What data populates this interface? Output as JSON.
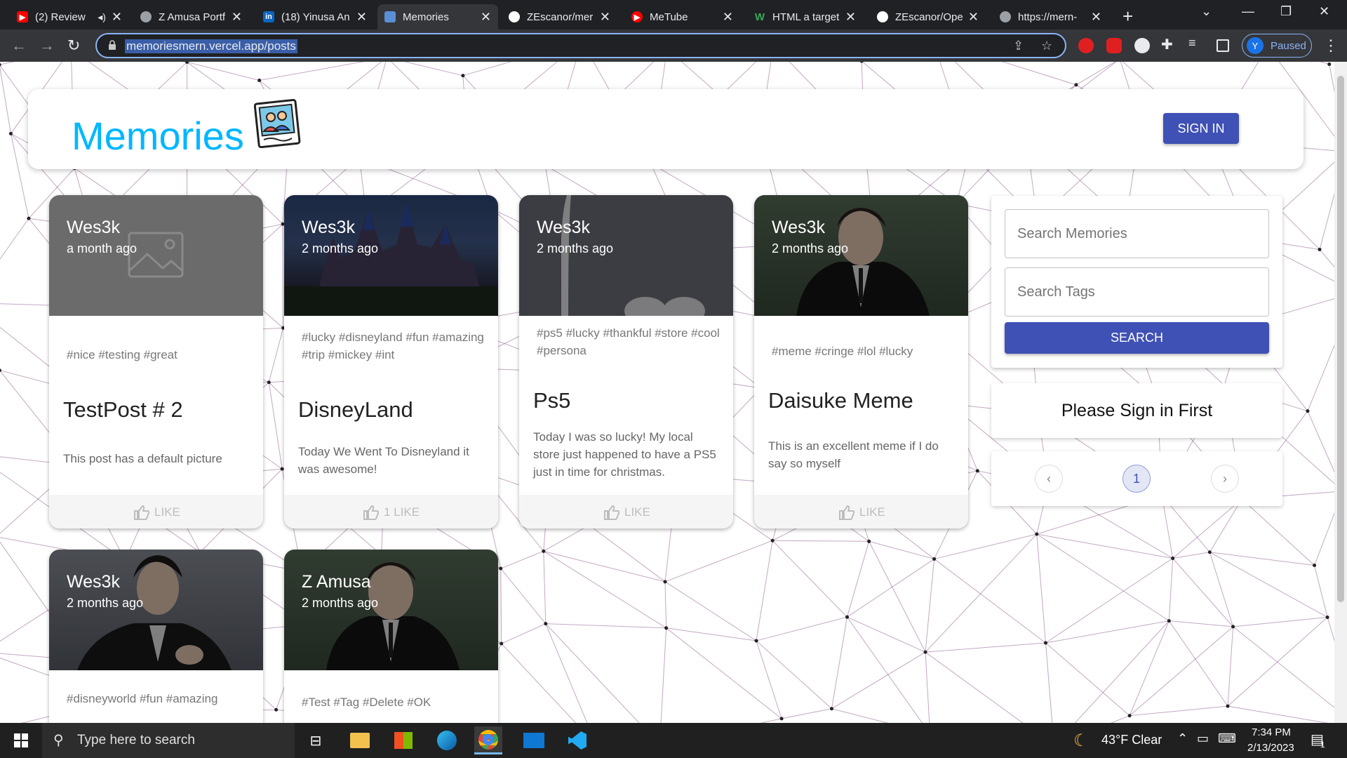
{
  "browser": {
    "tabs": [
      {
        "label": "(2) Review",
        "favicon_color": "#ff0000",
        "active": false
      },
      {
        "label": "Z Amusa Portf",
        "favicon_color": "#9aa0a6",
        "active": false
      },
      {
        "label": "(18) Yinusa An",
        "favicon_color": "#0a66c2",
        "favicon_text": "in",
        "active": false
      },
      {
        "label": "Memories",
        "favicon_color": "#5a8fd6",
        "active": true
      },
      {
        "label": "ZEscanor/mer",
        "favicon_color": "#ffffff",
        "active": false
      },
      {
        "label": "MeTube",
        "favicon_color": "#ff0000",
        "active": false
      },
      {
        "label": "HTML a target",
        "favicon_color": "#3aa757",
        "favicon_text": "W",
        "active": false
      },
      {
        "label": "ZEscanor/Ope",
        "favicon_color": "#ffffff",
        "active": false
      },
      {
        "label": "https://mern-",
        "favicon_color": "#9aa0a6",
        "active": false
      }
    ],
    "url": "memoriesmern.vercel.app/posts",
    "profile_initial": "Y",
    "profile_status": "Paused"
  },
  "app": {
    "brand": "Memories",
    "signin_label": "SIGN IN"
  },
  "posts": [
    {
      "author": "Wes3k",
      "time": "a month ago",
      "tags": "#nice #testing #great",
      "title": "TestPost # 2",
      "message": "This post has a default picture",
      "like_label": "LIKE",
      "media": "placeholder"
    },
    {
      "author": "Wes3k",
      "time": "2 months ago",
      "tags": "#lucky #disneyland #fun #amazing #trip #mickey #int",
      "title": "DisneyLand",
      "message": "Today We Went To Disneyland it was awesome!",
      "like_label": "1 LIKE",
      "media": "castle"
    },
    {
      "author": "Wes3k",
      "time": "2 months ago",
      "tags": "#ps5 #lucky #thankful #store #cool #persona",
      "title": "Ps5",
      "message": "Today I was so lucky! My local store just happened to have a PS5 just in time for christmas.",
      "like_label": "LIKE",
      "media": "ps5"
    },
    {
      "author": "Wes3k",
      "time": "2 months ago",
      "tags": "#meme #cringe #lol #lucky",
      "title": "Daisuke Meme",
      "message": "This is an excellent meme if I do say so myself",
      "like_label": "LIKE",
      "media": "anime"
    },
    {
      "author": "Wes3k",
      "time": "2 months ago",
      "tags": "#disneyworld #fun #amazing",
      "title": "",
      "message": "",
      "like_label": "",
      "media": "anime2"
    },
    {
      "author": "Z Amusa",
      "time": "2 months ago",
      "tags": "#Test #Tag #Delete #OK",
      "title": "",
      "message": "",
      "like_label": "",
      "media": "anime"
    }
  ],
  "sidebar": {
    "search_memories_placeholder": "Search Memories",
    "search_tags_placeholder": "Search Tags",
    "search_button": "SEARCH",
    "notice": "Please Sign in First",
    "pagination": {
      "prev": "‹",
      "current": "1",
      "next": "›"
    }
  },
  "taskbar": {
    "search_placeholder": "Type here to search",
    "weather": "43°F  Clear",
    "time": "7:34 PM",
    "date": "2/13/2023",
    "notification_count": "1"
  },
  "colors": {
    "brand": "#00b7ff",
    "primary": "#3f51b5",
    "background_lines": "#7b3f7b"
  }
}
